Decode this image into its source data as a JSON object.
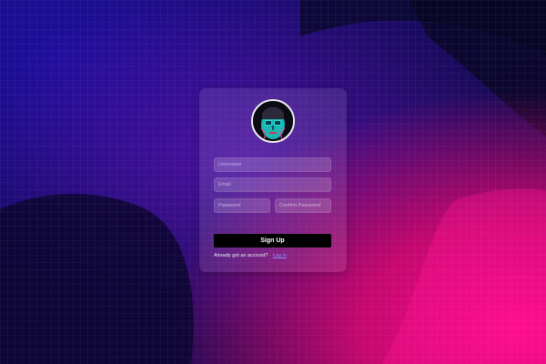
{
  "signup": {
    "avatar_icon": "user-face-avatar",
    "fields": {
      "username_placeholder": "Username",
      "email_placeholder": "Email",
      "password_placeholder": "Password",
      "confirm_password_placeholder": "Confirm Password"
    },
    "submit_label": "Sign Up",
    "footer_text": "Already got an account?",
    "login_link": "Log in"
  },
  "colors": {
    "background_dark": "#14093f",
    "background_pink": "#ff0a8a",
    "button": "#000000",
    "link": "#8c8cff"
  }
}
